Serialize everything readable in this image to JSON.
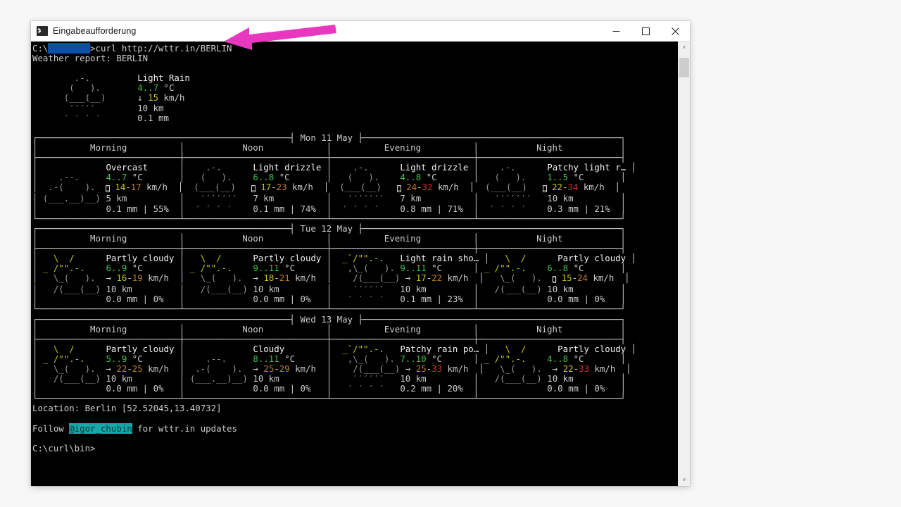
{
  "window": {
    "title": "Eingabeaufforderung",
    "icon": "console-icon",
    "minimize_label": "–",
    "maximize_label": "□",
    "close_label": "✕"
  },
  "annotation": {
    "arrow_color": "#e838c0",
    "arrow_direction": "left"
  },
  "terminal": {
    "prompt_prefix": "C:\\",
    "redacted_user": "████████",
    "prompt_suffix": ">",
    "command": "curl http://wttr.in/BERLIN",
    "report_line": "Weather report: BERLIN",
    "location_line": "Location: Berlin [52.52045,13.40732]",
    "follow_prefix": "Follow ",
    "follow_handle": "@igor_chubin",
    "follow_suffix": " for wttr.in updates",
    "final_prompt": "C:\\curl\\bin>",
    "scrollbar_up": "˄",
    "scrollbar_down": "˅"
  },
  "current": {
    "art": [
      "     .-.    ",
      "    (   ).  ",
      "   (___(__) ",
      "    ′′′′′  ",
      "   ′ ′ ′ ′  "
    ],
    "condition": "Light Rain",
    "temp": "4..7",
    "temp_unit": "°C",
    "wind_arrow": "↓",
    "wind": "15",
    "wind_unit": "km/h",
    "visibility": "10 km",
    "precip": "0.1 mm"
  },
  "forecast": [
    {
      "date": "Mon 11 May",
      "columns": [
        "Morning",
        "Noon",
        "Evening",
        "Night"
      ],
      "cells": [
        {
          "art_kind": "cloudy",
          "condition": "Overcast",
          "temp": "4..7",
          "wind_arrow": "tofu",
          "wind_low": "14",
          "wind_high": "17",
          "visibility": "5 km",
          "precip": "0.1 mm",
          "chance": "55%",
          "wind_low_color": "#c8c819",
          "wind_high_color": "#c07c28"
        },
        {
          "art_kind": "rain",
          "condition": "Light drizzle",
          "temp": "6..8",
          "wind_arrow": "tofu",
          "wind_low": "17",
          "wind_high": "23",
          "visibility": "7 km",
          "precip": "0.1 mm",
          "chance": "74%",
          "wind_low_color": "#c8c819",
          "wind_high_color": "#c07c28"
        },
        {
          "art_kind": "rain",
          "condition": "Light drizzle",
          "temp": "4..8",
          "wind_arrow": "tofu",
          "wind_low": "24",
          "wind_high": "32",
          "visibility": "7 km",
          "precip": "0.8 mm",
          "chance": "71%",
          "wind_low_color": "#c07c28",
          "wind_high_color": "#d03030"
        },
        {
          "art_kind": "rain",
          "condition": "Patchy light r…",
          "temp": "1..5",
          "wind_arrow": "tofu",
          "wind_low": "22",
          "wind_high": "34",
          "visibility": "10 km",
          "precip": "0.3 mm",
          "chance": "21%",
          "wind_low_color": "#c8c819",
          "wind_high_color": "#d03030"
        }
      ]
    },
    {
      "date": "Tue 12 May",
      "columns": [
        "Morning",
        "Noon",
        "Evening",
        "Night"
      ],
      "cells": [
        {
          "art_kind": "partly",
          "condition": "Partly cloudy",
          "temp": "6..9",
          "wind_arrow": "→",
          "wind_low": "16",
          "wind_high": "19",
          "visibility": "10 km",
          "precip": "0.0 mm",
          "chance": "0%",
          "wind_low_color": "#c8c819",
          "wind_high_color": "#c07c28"
        },
        {
          "art_kind": "partly",
          "condition": "Partly cloudy",
          "temp": "9..11",
          "wind_arrow": "→",
          "wind_low": "18",
          "wind_high": "21",
          "visibility": "10 km",
          "precip": "0.0 mm",
          "chance": "0%",
          "wind_low_color": "#c8c819",
          "wind_high_color": "#c07c28"
        },
        {
          "art_kind": "showers",
          "condition": "Light rain sho…",
          "temp": "9..11",
          "wind_arrow": "→",
          "wind_low": "17",
          "wind_high": "22",
          "visibility": "10 km",
          "precip": "0.1 mm",
          "chance": "23%",
          "wind_low_color": "#c8c819",
          "wind_high_color": "#c07c28"
        },
        {
          "art_kind": "partly",
          "condition": "Partly cloudy",
          "temp": "6..8",
          "wind_arrow": "tofu",
          "wind_low": "15",
          "wind_high": "24",
          "visibility": "10 km",
          "precip": "0.0 mm",
          "chance": "0%",
          "wind_low_color": "#c8c819",
          "wind_high_color": "#c07c28"
        }
      ]
    },
    {
      "date": "Wed 13 May",
      "columns": [
        "Morning",
        "Noon",
        "Evening",
        "Night"
      ],
      "cells": [
        {
          "art_kind": "partly",
          "condition": "Partly cloudy",
          "temp": "5..9",
          "wind_arrow": "→",
          "wind_low": "22",
          "wind_high": "25",
          "visibility": "10 km",
          "precip": "0.0 mm",
          "chance": "0%",
          "wind_low_color": "#c07c28",
          "wind_high_color": "#c07c28"
        },
        {
          "art_kind": "cloudy",
          "condition": "Cloudy",
          "temp": "8..11",
          "wind_arrow": "→",
          "wind_low": "25",
          "wind_high": "29",
          "visibility": "10 km",
          "precip": "0.0 mm",
          "chance": "0%",
          "wind_low_color": "#c07c28",
          "wind_high_color": "#c07c28"
        },
        {
          "art_kind": "showers",
          "condition": "Patchy rain po…",
          "temp": "7..10",
          "wind_arrow": "→",
          "wind_low": "25",
          "wind_high": "33",
          "visibility": "10 km",
          "precip": "0.2 mm",
          "chance": "20%",
          "wind_low_color": "#c07c28",
          "wind_high_color": "#d03030"
        },
        {
          "art_kind": "partly",
          "condition": "Partly cloudy",
          "temp": "4..8",
          "wind_arrow": "→",
          "wind_low": "22",
          "wind_high": "33",
          "visibility": "10 km",
          "precip": "0.0 mm",
          "chance": "0%",
          "wind_low_color": "#c8c819",
          "wind_high_color": "#d03030"
        }
      ]
    }
  ]
}
